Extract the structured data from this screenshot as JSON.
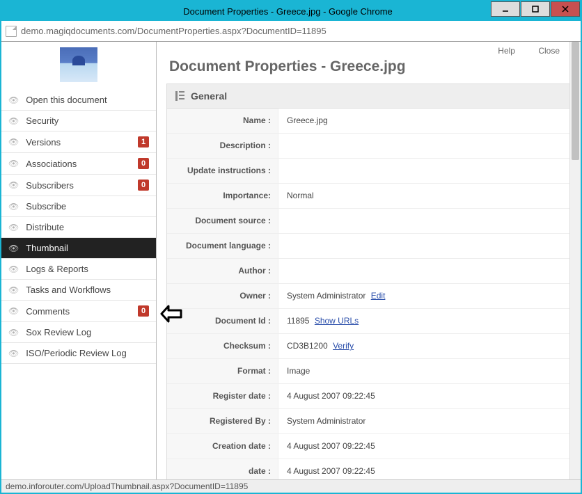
{
  "window": {
    "title": "Document Properties - Greece.jpg - Google Chrome"
  },
  "address": {
    "url": "demo.magiqdocuments.com/DocumentProperties.aspx?DocumentID=11895"
  },
  "sidebar": {
    "items": [
      {
        "label": "Open this document",
        "badge": null
      },
      {
        "label": "Security",
        "badge": null
      },
      {
        "label": "Versions",
        "badge": "1"
      },
      {
        "label": "Associations",
        "badge": "0"
      },
      {
        "label": "Subscribers",
        "badge": "0"
      },
      {
        "label": "Subscribe",
        "badge": null
      },
      {
        "label": "Distribute",
        "badge": null
      },
      {
        "label": "Thumbnail",
        "badge": null
      },
      {
        "label": "Logs & Reports",
        "badge": null
      },
      {
        "label": "Tasks and Workflows",
        "badge": null
      },
      {
        "label": "Comments",
        "badge": "0"
      },
      {
        "label": "Sox Review Log",
        "badge": null
      },
      {
        "label": "ISO/Periodic Review Log",
        "badge": null
      }
    ],
    "active_index": 7
  },
  "toplinks": {
    "help": "Help",
    "close": "Close"
  },
  "page": {
    "title": "Document Properties - Greece.jpg"
  },
  "panel": {
    "header": "General"
  },
  "fields": [
    {
      "key": "Name :",
      "val": "Greece.jpg"
    },
    {
      "key": "Description :",
      "val": ""
    },
    {
      "key": "Update instructions :",
      "val": ""
    },
    {
      "key": "Importance:",
      "val": "Normal"
    },
    {
      "key": "Document source :",
      "val": ""
    },
    {
      "key": "Document language :",
      "val": ""
    },
    {
      "key": "Author :",
      "val": ""
    },
    {
      "key": "Owner :",
      "val": "System Administrator",
      "link": "Edit"
    },
    {
      "key": "Document Id :",
      "val": "11895",
      "link": "Show URLs"
    },
    {
      "key": "Checksum :",
      "val": "CD3B1200",
      "link": "Verify",
      "link_inline": true
    },
    {
      "key": "Format :",
      "val": "Image"
    },
    {
      "key": "Register date :",
      "val": "4 August 2007 09:22:45"
    },
    {
      "key": "Registered By :",
      "val": "System Administrator"
    },
    {
      "key": "Creation date :",
      "val": "4 August 2007 09:22:45"
    },
    {
      "key": "date :",
      "val": "4 August 2007 09:22:45"
    }
  ],
  "status": {
    "text": "demo.inforouter.com/UploadThumbnail.aspx?DocumentID=11895"
  }
}
